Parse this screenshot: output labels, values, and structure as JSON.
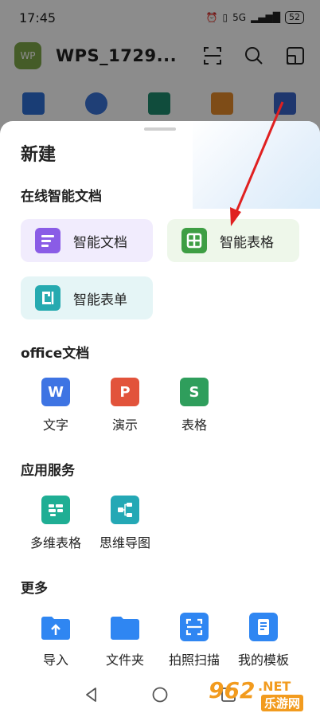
{
  "status": {
    "time": "17:45",
    "signal_label": "5G",
    "battery": "52"
  },
  "header": {
    "avatar_text": "WP",
    "title": "WPS_1729..."
  },
  "sheet": {
    "title": "新建",
    "online_section": "在线智能文档",
    "online_items": [
      {
        "label": "智能文档",
        "icon": "smart-doc-icon",
        "color": "#8a5ce6",
        "bg": "#f1ecfd"
      },
      {
        "label": "智能表格",
        "icon": "smart-sheet-icon",
        "color": "#3e9e44",
        "bg": "#eef7ea"
      },
      {
        "label": "智能表单",
        "icon": "smart-form-icon",
        "color": "#26aab0",
        "bg": "#e5f5f6"
      }
    ],
    "office_section": "office文档",
    "office_items": [
      {
        "label": "文字",
        "glyph": "W",
        "color": "#3e74e3"
      },
      {
        "label": "演示",
        "glyph": "P",
        "color": "#e2533b"
      },
      {
        "label": "表格",
        "glyph": "S",
        "color": "#2f9e5c"
      }
    ],
    "service_section": "应用服务",
    "service_items": [
      {
        "label": "多维表格",
        "color": "#1fae94"
      },
      {
        "label": "思维导图",
        "color": "#24a8b5"
      }
    ],
    "more_section": "更多",
    "more_items": [
      {
        "label": "导入",
        "color": "#2f86f2"
      },
      {
        "label": "文件夹",
        "color": "#2f86f2"
      },
      {
        "label": "拍照扫描",
        "color": "#2f86f2"
      },
      {
        "label": "我的模板",
        "color": "#2f86f2"
      }
    ]
  },
  "watermark": {
    "number": "962",
    "suffix": ".NET",
    "cn": "乐游网"
  },
  "accent_red": "#e02020"
}
